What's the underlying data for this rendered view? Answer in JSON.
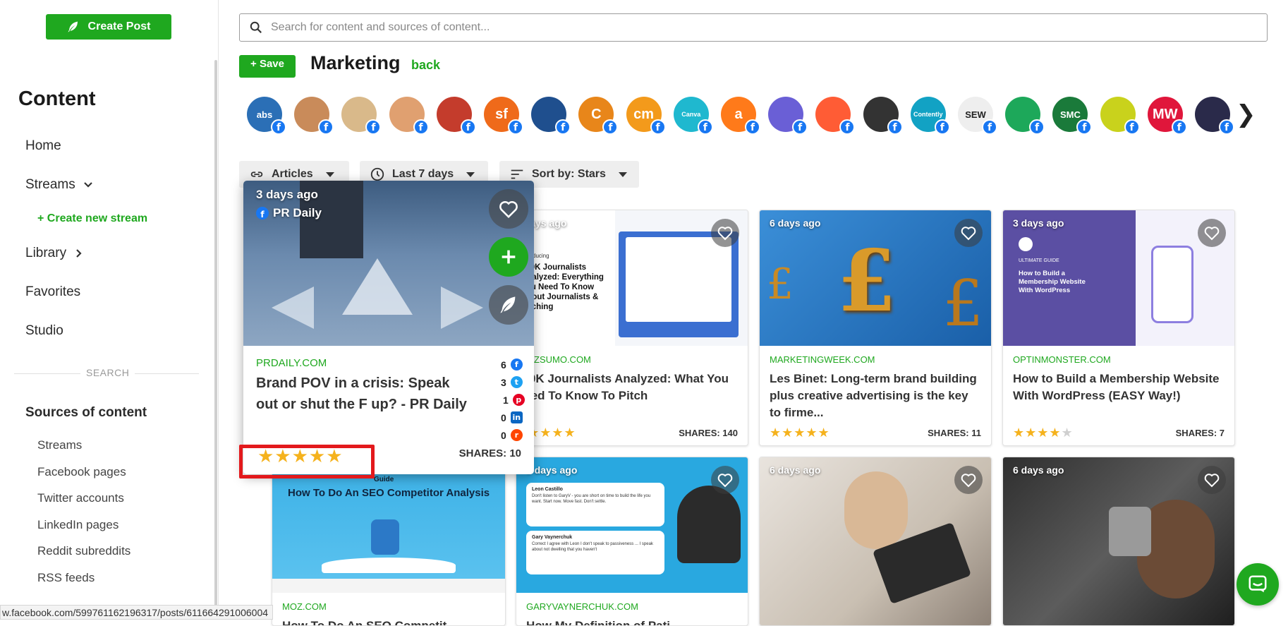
{
  "sidebar": {
    "create_post_label": "Create Post",
    "title": "Content",
    "nav": {
      "home": "Home",
      "streams": "Streams",
      "create_stream": "+ Create new stream",
      "library": "Library",
      "favorites": "Favorites",
      "studio": "Studio"
    },
    "search_label": "SEARCH",
    "sources_title": "Sources of content",
    "sources": [
      "Streams",
      "Facebook pages",
      "Twitter accounts",
      "LinkedIn pages",
      "Reddit subreddits",
      "RSS feeds"
    ]
  },
  "status_url": "w.facebook.com/599761162196317/posts/611664291006004",
  "search": {
    "placeholder": "Search for content and sources of content..."
  },
  "header": {
    "save_label": "+ Save",
    "page_title": "Marketing",
    "back_label": "back"
  },
  "avatars": [
    {
      "label": "abs",
      "color": "#2b6fb6"
    },
    {
      "label": "",
      "color": "#c98b5a"
    },
    {
      "label": "",
      "color": "#d9b98a"
    },
    {
      "label": "",
      "color": "#e0a070"
    },
    {
      "label": "",
      "color": "#c43c2c"
    },
    {
      "label": "sf",
      "color": "#ef6a1a"
    },
    {
      "label": "",
      "color": "#1f4f8e"
    },
    {
      "label": "C",
      "color": "#e8861a"
    },
    {
      "label": "cm",
      "color": "#f39a1b"
    },
    {
      "label": "Canva",
      "color": "#1fb8cf"
    },
    {
      "label": "a",
      "color": "#ff7a1a"
    },
    {
      "label": "",
      "color": "#6a5fd6"
    },
    {
      "label": "",
      "color": "#ff5c35"
    },
    {
      "label": "",
      "color": "#333333"
    },
    {
      "label": "Contently",
      "color": "#12a2c4"
    },
    {
      "label": "SEW",
      "color": "#eeeeee"
    },
    {
      "label": "",
      "color": "#1da85a"
    },
    {
      "label": "SMC",
      "color": "#1a7a3a"
    },
    {
      "label": "",
      "color": "#c9d21c"
    },
    {
      "label": "MW",
      "color": "#e0163b"
    },
    {
      "label": "",
      "color": "#2a2a4a"
    }
  ],
  "filters": {
    "type": "Articles",
    "time": "Last 7 days",
    "sort": "Sort by: Stars"
  },
  "popup": {
    "age": "3 days ago",
    "source": "PR Daily",
    "domain": "PRDAILY.COM",
    "title": "Brand POV in a crisis: Speak out or shut the F up? - PR Daily",
    "counts": {
      "facebook": "6",
      "twitter": "3",
      "pinterest": "1",
      "linkedin": "0",
      "reddit": "0"
    },
    "rating": 5,
    "stars": "★★★★★",
    "shares": "SHARES: 10"
  },
  "cards": [
    {
      "age": "6 days ago",
      "domain": "BUZZSUMO.COM",
      "title": "100K Journalists Analyzed: What You Need To Know To Pitch",
      "rating": 5,
      "stars": "★★★★★",
      "shares": "SHARES: 140"
    },
    {
      "age": "6 days ago",
      "domain": "MARKETINGWEEK.COM",
      "title": "Les Binet: Long-term brand building plus creative advertising is the key to firme...",
      "rating": 5,
      "stars": "★★★★★",
      "shares": "SHARES: 11"
    },
    {
      "age": "3 days ago",
      "domain": "OPTINMONSTER.COM",
      "title": "How to Build a Membership Website With WordPress (EASY Way!)",
      "rating": 4,
      "stars": "★★★★",
      "stars_off": "★",
      "shares": "SHARES: 7"
    },
    {
      "age": "",
      "domain": "MOZ.COM",
      "title": "How To Do An SEO Competit...",
      "thumb_text": "How To Do An SEO Competitor Analysis",
      "thumb_tag": "Guide"
    },
    {
      "age": "6 days ago",
      "domain": "GARYVAYNERCHUK.COM",
      "title": "How My Definition of Pati..."
    },
    {
      "age": "6 days ago",
      "domain": "",
      "title": ""
    },
    {
      "age": "6 days ago",
      "domain": "",
      "title": ""
    }
  ],
  "buzzsumo_thumb": {
    "intro": "Introducing",
    "headline": "100K Journalists Analyzed: Everything You Need To Know About Journalists & Pitching"
  },
  "optin_thumb": {
    "tag": "ULTIMATE GUIDE",
    "headline": "How to Build a Membership Website With WordPress"
  },
  "gary_thumb": {
    "name1": "Leon Castillo",
    "msg1": "Don't listen to GaryV - you are short on time to build the life you want. Start now. Move fast. Don't settle.",
    "name2": "Gary Vaynerchuk",
    "msg2": "Correct I agree with Leon I don't speak to passiveness ... I speak about not dwelling that you haven't"
  },
  "colors": {
    "brand_green": "#1fa81f",
    "highlight_red": "#e3191c",
    "star": "#f5b21d"
  }
}
